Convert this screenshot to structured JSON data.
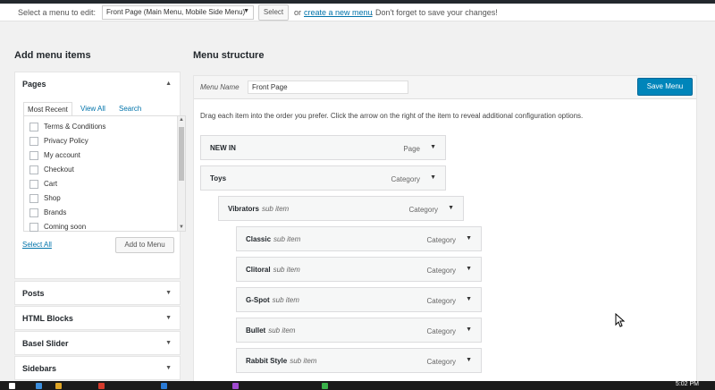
{
  "top": {
    "select_label": "Select a menu to edit:",
    "menu_select_value": "Front Page (Main Menu, Mobile Side Menu)",
    "select_button": "Select",
    "or_text": "or",
    "create_link": "create a new menu",
    "dont_forget": ". Don't forget to save your changes!"
  },
  "left": {
    "heading": "Add menu items",
    "pages_title": "Pages",
    "tabs": [
      "Most Recent",
      "View All",
      "Search"
    ],
    "pages": [
      "Terms & Conditions",
      "Privacy Policy",
      "My account",
      "Checkout",
      "Cart",
      "Shop",
      "Brands",
      "Coming soon"
    ],
    "select_all": "Select All",
    "add_to_menu": "Add to Menu",
    "sections": [
      "Posts",
      "HTML Blocks",
      "Basel Slider",
      "Sidebars"
    ]
  },
  "right": {
    "heading": "Menu structure",
    "menu_name_label": "Menu Name",
    "menu_name_value": "Front Page",
    "save_button": "Save Menu",
    "instructions": "Drag each item into the order you prefer. Click the arrow on the right of the item to reveal additional configuration options.",
    "items": [
      {
        "title": "NEW IN",
        "sub": "",
        "type": "Page",
        "depth": 0
      },
      {
        "title": "Toys",
        "sub": "",
        "type": "Category",
        "depth": 0
      },
      {
        "title": "Vibrators",
        "sub": "sub item",
        "type": "Category",
        "depth": 1
      },
      {
        "title": "Classic",
        "sub": "sub item",
        "type": "Category",
        "depth": 2
      },
      {
        "title": "Clitoral",
        "sub": "sub item",
        "type": "Category",
        "depth": 2
      },
      {
        "title": "G-Spot",
        "sub": "sub item",
        "type": "Category",
        "depth": 2
      },
      {
        "title": "Bullet",
        "sub": "sub item",
        "type": "Category",
        "depth": 2
      },
      {
        "title": "Rabbit Style",
        "sub": "sub item",
        "type": "Category",
        "depth": 2
      }
    ]
  },
  "icons": {
    "dropdown": "chevron-down-icon",
    "collapse": "chevron-up-icon"
  },
  "colors": {
    "primary_button": "#0085ba",
    "link": "#0073aa"
  },
  "taskbar": {
    "clock": "5:02 PM"
  }
}
